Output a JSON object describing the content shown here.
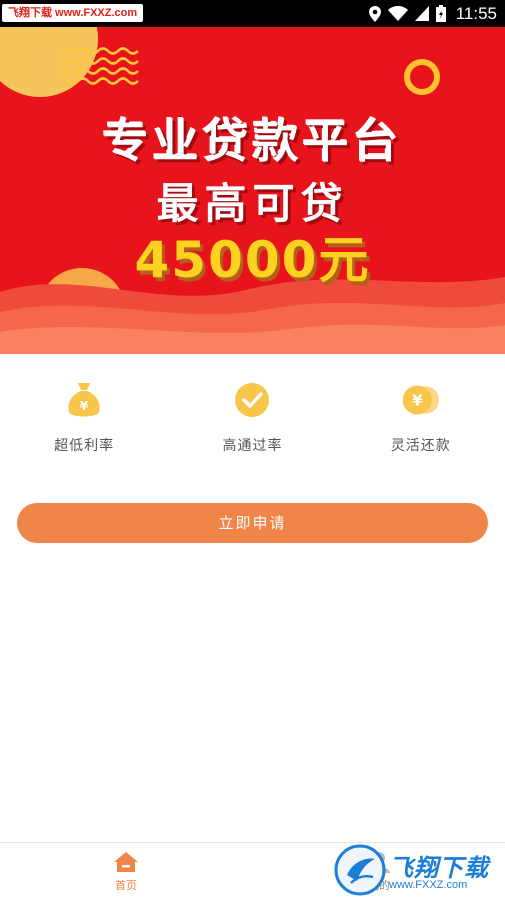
{
  "status_bar": {
    "watermark_tag": "飞翔下载 www.FXXZ.com",
    "time": "11:55"
  },
  "banner": {
    "title": "专业贷款平台",
    "subtitle": "最高可贷",
    "amount": "45000元"
  },
  "features": [
    {
      "label": "超低利率",
      "icon": "money-bag-icon"
    },
    {
      "label": "高通过率",
      "icon": "check-circle-icon"
    },
    {
      "label": "灵活还款",
      "icon": "coins-icon"
    }
  ],
  "apply_button": {
    "label": "立即申请"
  },
  "bottom_nav": {
    "items": [
      {
        "label": "首页",
        "icon": "home-icon",
        "active": true
      },
      {
        "label": "我的",
        "icon": "user-icon",
        "active": false
      }
    ]
  },
  "watermark": {
    "text": "飞翔下载",
    "url": "www.FXXZ.com"
  },
  "colors": {
    "banner_red": "#e8141b",
    "accent_orange": "#f0854a",
    "icon_yellow": "#f7c64a",
    "amount_yellow": "#ffd21f"
  }
}
